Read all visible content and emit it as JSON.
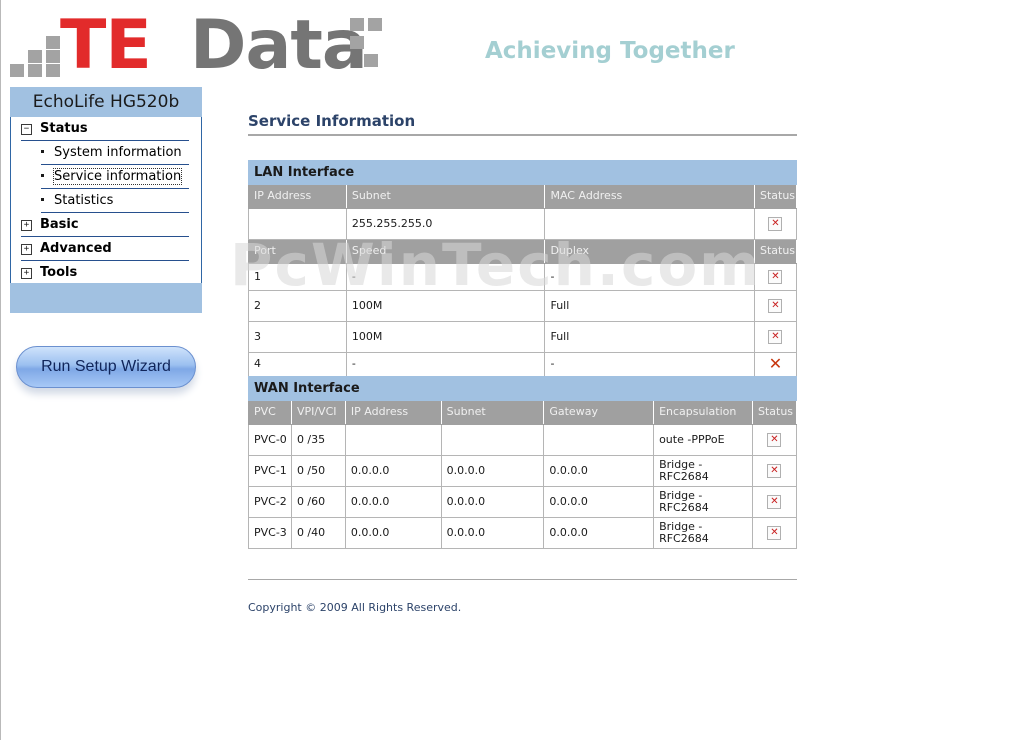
{
  "header": {
    "logo_te": "TE",
    "logo_data": "Data",
    "slogan": "Achieving Together",
    "logo_colors": {
      "red": "#e22b2b",
      "gray": "#757575",
      "squares": "#a3a3a3"
    }
  },
  "sidebar": {
    "title": "EchoLife HG520b",
    "menu": [
      {
        "label": "Status",
        "expander": "−",
        "expanded": true,
        "children": [
          "System information",
          "Service information",
          "Statistics"
        ],
        "selected_child": "Service information"
      },
      {
        "label": "Basic",
        "expander": "+"
      },
      {
        "label": "Advanced",
        "expander": "+"
      },
      {
        "label": "Tools",
        "expander": "+"
      }
    ],
    "wizard_button": "Run Setup Wizard"
  },
  "main": {
    "title": "Service Information",
    "lan": {
      "section": "LAN Interface",
      "headers": [
        "IP Address",
        "Subnet",
        "MAC Address",
        "Status"
      ],
      "row": {
        "ip": "",
        "subnet": "255.255.255.0",
        "mac": ""
      },
      "port_headers": [
        "Port",
        "Speed",
        "Duplex",
        "Status"
      ],
      "ports": [
        {
          "port": "1",
          "speed": "-",
          "duplex": "-"
        },
        {
          "port": "2",
          "speed": "100M",
          "duplex": "Full"
        },
        {
          "port": "3",
          "speed": "100M",
          "duplex": "Full"
        },
        {
          "port": "4",
          "speed": "-",
          "duplex": "-"
        }
      ]
    },
    "wan": {
      "section": "WAN Interface",
      "headers": [
        "PVC",
        "VPI/VCI",
        "IP Address",
        "Subnet",
        "Gateway",
        "Encapsulation",
        "Status"
      ],
      "rows": [
        {
          "pvc": "PVC-0",
          "vpivci": "0 /35",
          "ip": "",
          "subnet": "",
          "gateway": "",
          "encap": "oute -PPPoE"
        },
        {
          "pvc": "PVC-1",
          "vpivci": "0 /50",
          "ip": "0.0.0.0",
          "subnet": "0.0.0.0",
          "gateway": "0.0.0.0",
          "encap": "Bridge - RFC2684"
        },
        {
          "pvc": "PVC-2",
          "vpivci": "0 /60",
          "ip": "0.0.0.0",
          "subnet": "0.0.0.0",
          "gateway": "0.0.0.0",
          "encap": "Bridge - RFC2684"
        },
        {
          "pvc": "PVC-3",
          "vpivci": "0 /40",
          "ip": "0.0.0.0",
          "subnet": "0.0.0.0",
          "gateway": "0.0.0.0",
          "encap": "Bridge - RFC2684"
        }
      ]
    },
    "status_icon": "✕",
    "footer": "Copyright © 2009 All Rights Reserved."
  },
  "watermark": "PcWinTech.com"
}
